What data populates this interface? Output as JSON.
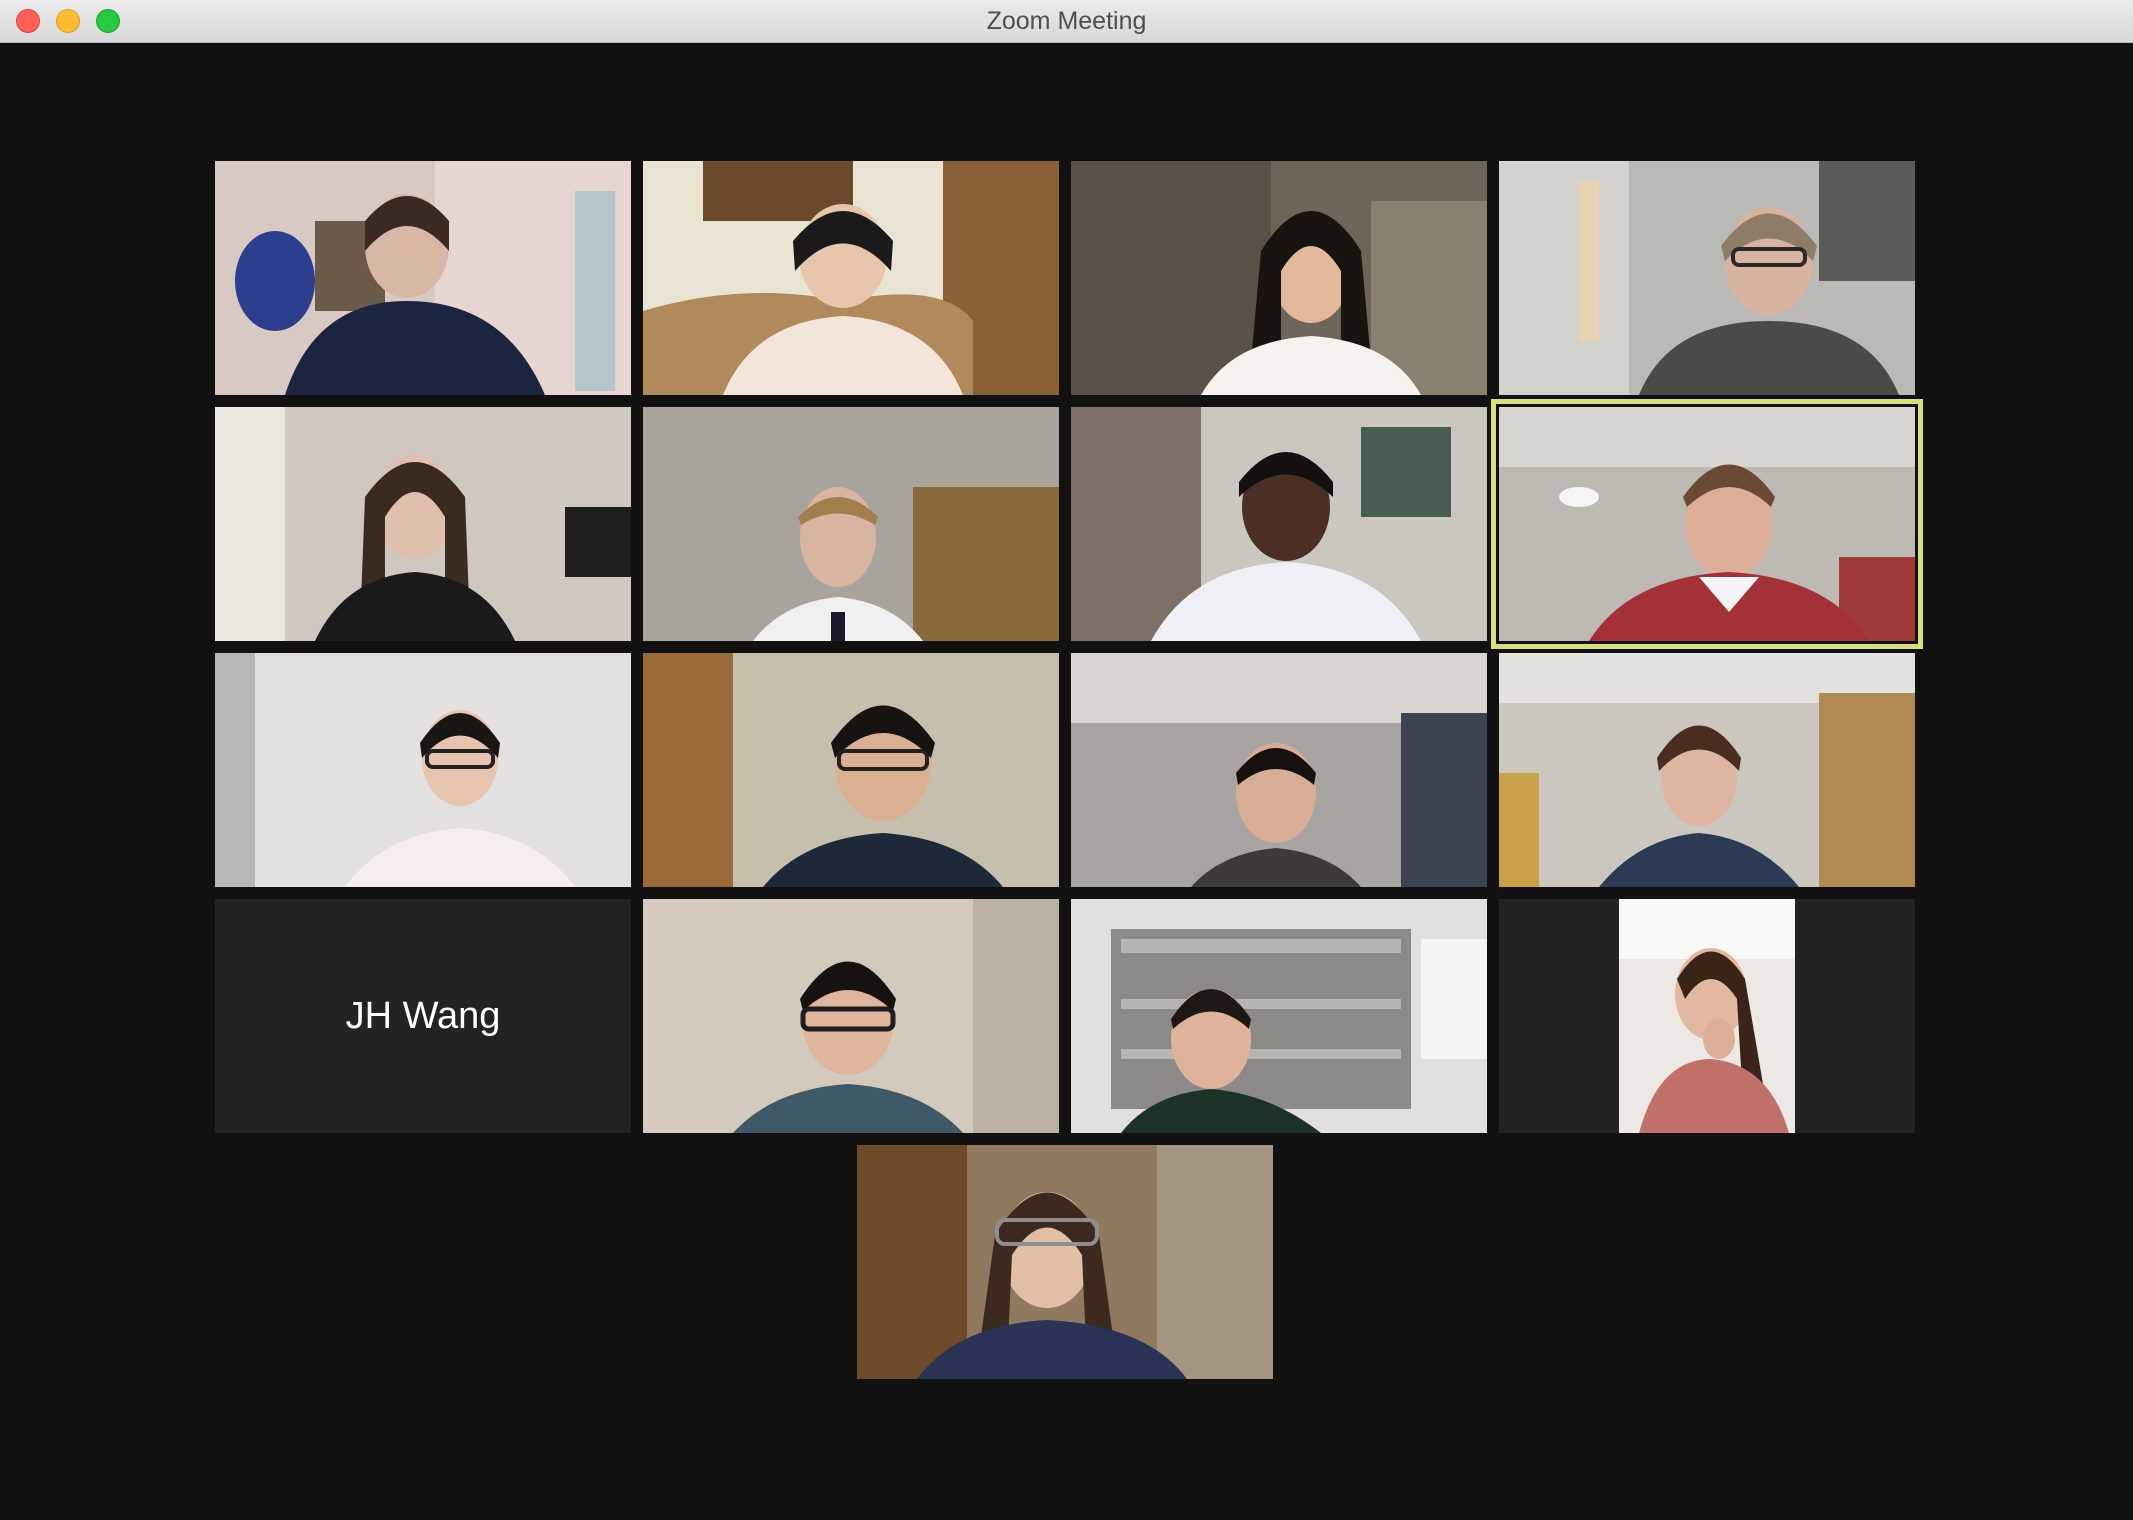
{
  "window": {
    "title": "Zoom Meeting"
  },
  "controls": {
    "close_icon": "close-icon",
    "minimize_icon": "minimize-icon",
    "zoom_icon": "zoom-icon"
  },
  "participants": [
    {
      "name": "",
      "video": "on",
      "icon": "video-feed"
    },
    {
      "name": "",
      "video": "on",
      "icon": "video-feed"
    },
    {
      "name": "",
      "video": "on",
      "icon": "video-feed"
    },
    {
      "name": "",
      "video": "on",
      "icon": "video-feed"
    },
    {
      "name": "",
      "video": "on",
      "icon": "video-feed"
    },
    {
      "name": "",
      "video": "on",
      "icon": "video-feed"
    },
    {
      "name": "",
      "video": "on",
      "icon": "video-feed"
    },
    {
      "name": "",
      "video": "on",
      "icon": "video-feed",
      "active_speaker": true
    },
    {
      "name": "",
      "video": "on",
      "icon": "video-feed"
    },
    {
      "name": "",
      "video": "on",
      "icon": "video-feed"
    },
    {
      "name": "",
      "video": "on",
      "icon": "video-feed"
    },
    {
      "name": "",
      "video": "on",
      "icon": "video-feed"
    },
    {
      "name": "JH Wang",
      "video": "off"
    },
    {
      "name": "",
      "video": "on",
      "icon": "video-feed"
    },
    {
      "name": "",
      "video": "on",
      "icon": "video-feed"
    },
    {
      "name": "",
      "video": "on",
      "icon": "video-feed",
      "portrait": true
    },
    {
      "name": "",
      "video": "on",
      "icon": "video-feed"
    }
  ],
  "colors": {
    "background": "#111111",
    "active_speaker_border": "#d6e07a",
    "tile_off": "#232323"
  }
}
